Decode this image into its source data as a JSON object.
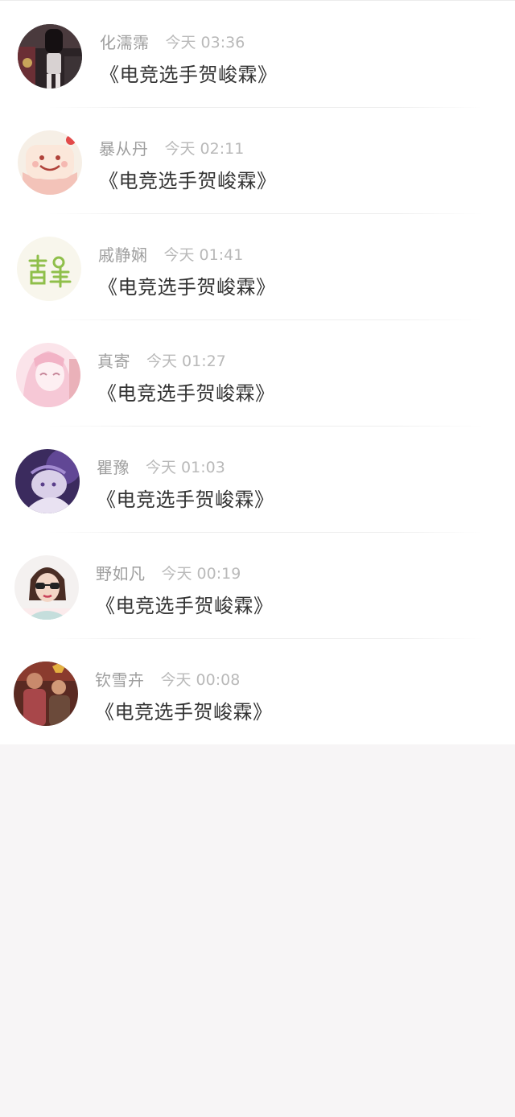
{
  "comments": [
    {
      "name": "化濡霈",
      "time": "今天 03:36",
      "text": "《电竞选手贺峻霖》",
      "avatar_icon": "avatar-dark-street-photo"
    },
    {
      "name": "暴从丹",
      "time": "今天 02:11",
      "text": "《电竞选手贺峻霖》",
      "avatar_icon": "avatar-cute-cake-face"
    },
    {
      "name": "戚静娴",
      "time": "今天 01:41",
      "text": "《电竞选手贺峻霖》",
      "avatar_icon": "avatar-green-calligraphy"
    },
    {
      "name": "真寄",
      "time": "今天 01:27",
      "text": "《电竞选手贺峻霖》",
      "avatar_icon": "avatar-pink-anime-girl"
    },
    {
      "name": "瞿豫",
      "time": "今天 01:03",
      "text": "《电竞选手贺峻霖》",
      "avatar_icon": "avatar-purple-anime-art"
    },
    {
      "name": "野如凡",
      "time": "今天 00:19",
      "text": "《电竞选手贺峻霖》",
      "avatar_icon": "avatar-sunglasses-girl"
    },
    {
      "name": "钦雪卉",
      "time": "今天 00:08",
      "text": "《电竞选手贺峻霖》",
      "avatar_icon": "avatar-two-kids-photo"
    }
  ],
  "colors": {
    "page_background": "#f7f5f6",
    "list_background": "#ffffff",
    "name_text": "#9e9e9e",
    "time_text": "#b9b9b9",
    "content_text": "#333333"
  }
}
